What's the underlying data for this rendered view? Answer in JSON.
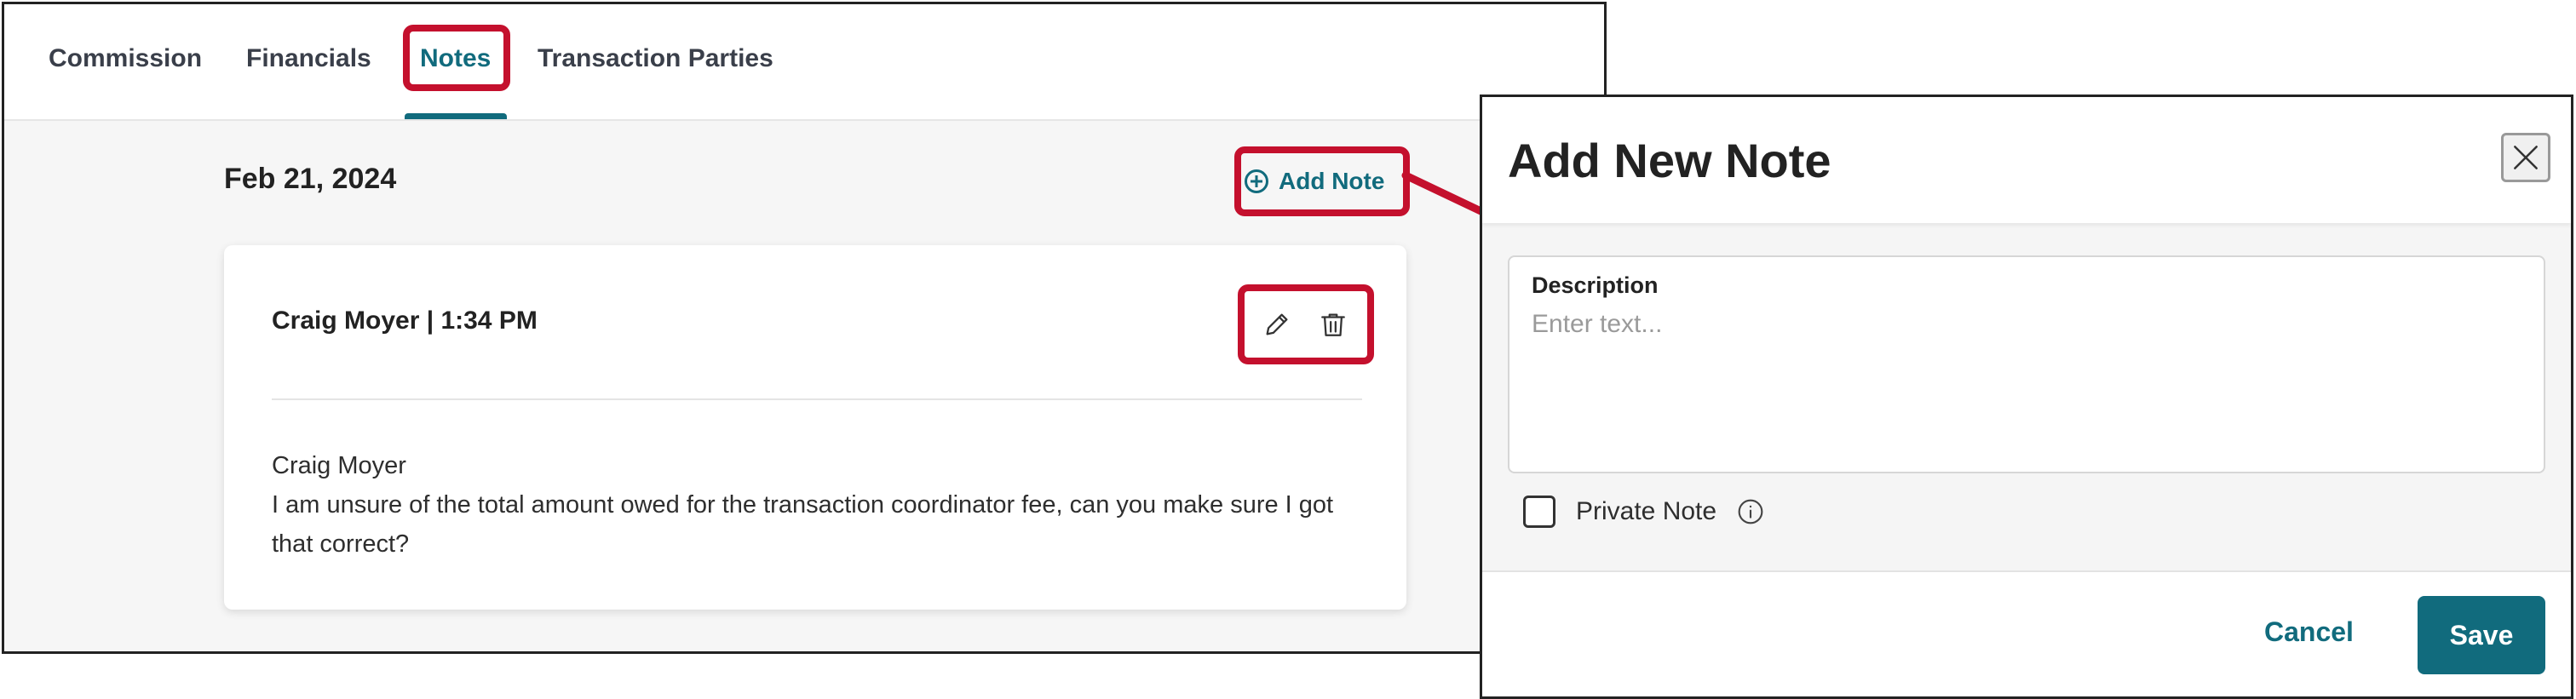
{
  "tabs": {
    "commission": "Commission",
    "financials": "Financials",
    "notes": "Notes",
    "transaction_parties": "Transaction Parties",
    "active": "Notes"
  },
  "notes_page": {
    "date": "Feb 21, 2024",
    "add_note_label": "Add Note",
    "note": {
      "author_time": "Craig Moyer | 1:34 PM",
      "body_author": "Craig Moyer",
      "body_text": "I am unsure of the total amount owed for the transaction coordinator fee, can you make sure I got that correct?",
      "actions": [
        "pencil-icon",
        "trash-icon"
      ]
    }
  },
  "modal": {
    "title": "Add New Note",
    "description_label": "Description",
    "description_placeholder": "Enter text...",
    "description_value": "",
    "private_note_label": "Private Note",
    "private_note_checked": false,
    "cancel_label": "Cancel",
    "save_label": "Save"
  },
  "colors": {
    "accent": "#116b7d",
    "highlight": "#c4102d"
  }
}
